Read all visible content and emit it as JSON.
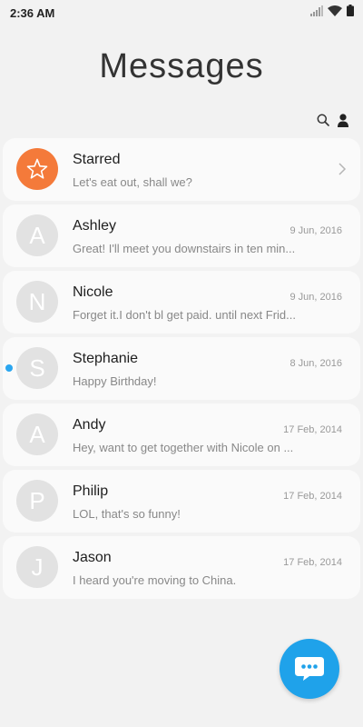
{
  "status_bar": {
    "time": "2:36 AM",
    "icons": [
      "signal-icon",
      "wifi-icon",
      "battery-icon"
    ]
  },
  "header": {
    "title": "Messages",
    "actions": [
      {
        "icon": "search-icon"
      },
      {
        "icon": "contacts-icon"
      }
    ]
  },
  "starred": {
    "name": "Starred",
    "preview": "Let's eat out, shall we?",
    "icon": "star-icon",
    "color": "#f47a3a"
  },
  "conversations": [
    {
      "initial": "A",
      "name": "Ashley",
      "date": "9 Jun, 2016",
      "preview": "Great! I'll meet you downstairs in ten min...",
      "unread": false
    },
    {
      "initial": "N",
      "name": "Nicole",
      "date": "9 Jun, 2016",
      "preview": "Forget it.I don't bl get paid. until next Frid...",
      "unread": false
    },
    {
      "initial": "S",
      "name": "Stephanie",
      "date": "8 Jun, 2016",
      "preview": "Happy Birthday!",
      "unread": true
    },
    {
      "initial": "A",
      "name": "Andy",
      "date": "17 Feb, 2014",
      "preview": "Hey, want to get together with Nicole on ...",
      "unread": false
    },
    {
      "initial": "P",
      "name": "Philip",
      "date": "17 Feb, 2014",
      "preview": "LOL, that's so funny!",
      "unread": false
    },
    {
      "initial": "J",
      "name": "Jason",
      "date": "17 Feb, 2014",
      "preview": "I heard you're moving to China.",
      "unread": false
    }
  ],
  "fab": {
    "icon": "compose-message-icon",
    "color": "#1fa2ea"
  },
  "colors": {
    "accent": "#1fa2ea",
    "unread_dot": "#2aa6f0",
    "star": "#f47a3a"
  }
}
